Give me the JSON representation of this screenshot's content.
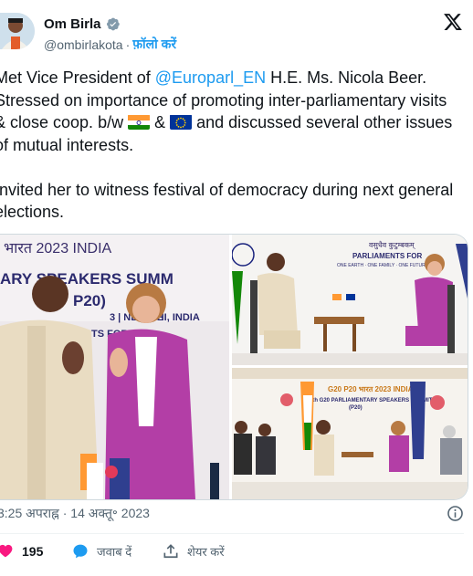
{
  "author": {
    "name": "Om Birla",
    "handle": "@ombirlakota",
    "separator": "·",
    "follow_label": "फ़ॉलो करें"
  },
  "tweet": {
    "part1": "Met Vice President of ",
    "mention": "@Europarl_EN",
    "part2": " H.E. Ms. Nicola Beer. Stressed on importance of promoting inter-parliamentary visits & close coop. b/w ",
    "part3": " & ",
    "part4": " and discussed several other issues of mutual interests.\n\nInvited her to witness festival of democracy during next general elections."
  },
  "media": {
    "main_banner_line1": "भारत 2023 INDIA",
    "main_banner_line2": "ARY SPEAKERS SUMM",
    "main_banner_line3": "P20)",
    "main_banner_line4": "3 | NEW DE",
    "main_banner_line5": "LHI, INDIA",
    "main_banner_line6": "TS FOR",
    "tr_banner_line1": "वसुधैव कुटुम्बकम्",
    "tr_banner_line2": "PARLIAMENTS FOR",
    "tr_banner_line3": "ONE EARTH · ONE FAMILY · ONE FUTURE",
    "br_banner_line1": "G20  P20  भारत 2023 INDIA",
    "br_banner_line2": "9th G20 PARLIAMENTARY SPEAKERS SUMMIT",
    "br_banner_line3": "(P20)"
  },
  "meta": {
    "timestamp": "3:25 अपराह्न · 14 अक्तू॰ 2023"
  },
  "actions": {
    "likes": "195",
    "reply_label": "जवाब दें",
    "share_label": "शेयर करें"
  }
}
